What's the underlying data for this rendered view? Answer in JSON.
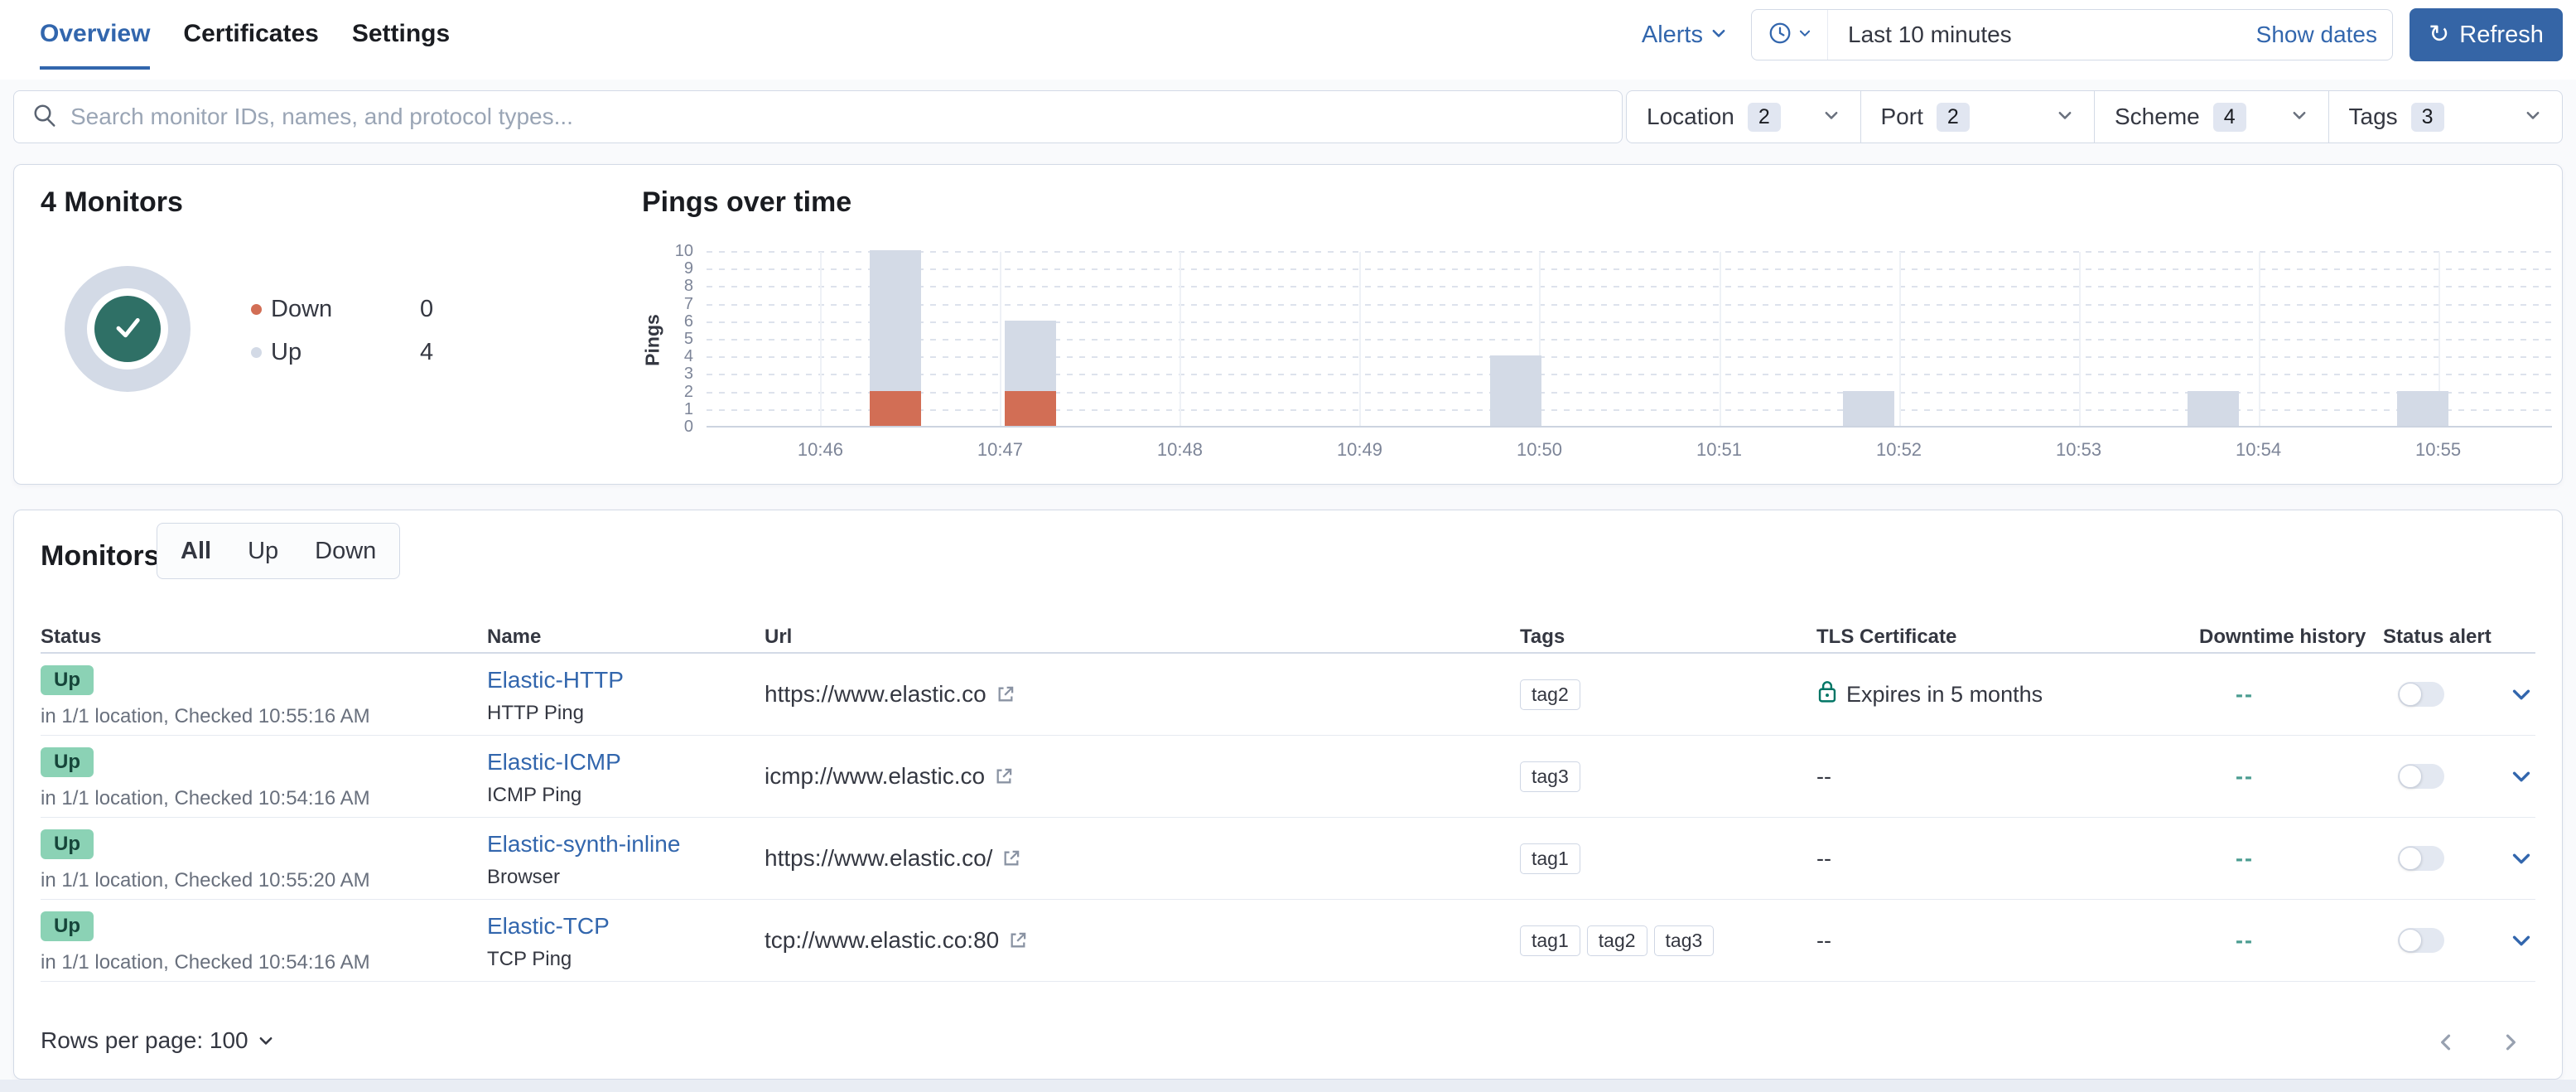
{
  "header": {
    "tabs": [
      {
        "label": "Overview",
        "active": true
      },
      {
        "label": "Certificates",
        "active": false
      },
      {
        "label": "Settings",
        "active": false
      }
    ],
    "alerts_label": "Alerts",
    "time_picker": {
      "range_label": "Last 10 minutes",
      "show_dates_label": "Show dates"
    },
    "refresh_label": "Refresh"
  },
  "search": {
    "placeholder": "Search monitor IDs, names, and protocol types..."
  },
  "filters": [
    {
      "label": "Location",
      "count": "2"
    },
    {
      "label": "Port",
      "count": "2"
    },
    {
      "label": "Scheme",
      "count": "4"
    },
    {
      "label": "Tags",
      "count": "3"
    }
  ],
  "summary": {
    "title": "4 Monitors",
    "legend": [
      {
        "label": "Down",
        "value": "0",
        "color": "#d26e55"
      },
      {
        "label": "Up",
        "value": "4",
        "color": "#d3dae6"
      }
    ]
  },
  "chart_data": {
    "type": "bar",
    "title": "Pings over time",
    "ylabel": "Pings",
    "ylim": [
      0,
      10
    ],
    "yticks": [
      0,
      1,
      2,
      3,
      4,
      5,
      6,
      7,
      8,
      9,
      10
    ],
    "xticks": [
      "10:46",
      "10:47",
      "10:48",
      "10:49",
      "10:50",
      "10:51",
      "10:52",
      "10:53",
      "10:54",
      "10:55"
    ],
    "x_domain": [
      "10:45:22",
      "10:55:38"
    ],
    "grid": true,
    "legend_position": "none",
    "series": [
      {
        "name": "Up",
        "color": "#d3dae6"
      },
      {
        "name": "Down",
        "color": "#d26e55"
      }
    ],
    "bars": [
      {
        "time": "10:46:25",
        "up": 8,
        "down": 2
      },
      {
        "time": "10:47:10",
        "up": 4,
        "down": 2
      },
      {
        "time": "10:49:52",
        "up": 4,
        "down": 0
      },
      {
        "time": "10:51:50",
        "up": 2,
        "down": 0
      },
      {
        "time": "10:53:45",
        "up": 2,
        "down": 0
      },
      {
        "time": "10:54:55",
        "up": 2,
        "down": 0
      }
    ]
  },
  "monitors": {
    "title": "Monitors",
    "status_tabs": [
      {
        "label": "All",
        "active": true
      },
      {
        "label": "Up",
        "active": false
      },
      {
        "label": "Down",
        "active": false
      }
    ],
    "columns": [
      "Status",
      "Name",
      "Url",
      "Tags",
      "TLS Certificate",
      "Downtime history",
      "Status alert"
    ],
    "rows": [
      {
        "status": "Up",
        "status_detail": "in 1/1 location, Checked 10:55:16 AM",
        "name": "Elastic-HTTP",
        "type": "HTTP Ping",
        "url": "https://www.elastic.co",
        "tags": [
          "tag2"
        ],
        "tls": "Expires in 5 months",
        "tls_has_lock": true,
        "downtime": "--",
        "alert_on": false
      },
      {
        "status": "Up",
        "status_detail": "in 1/1 location, Checked 10:54:16 AM",
        "name": "Elastic-ICMP",
        "type": "ICMP Ping",
        "url": "icmp://www.elastic.co",
        "tags": [
          "tag3"
        ],
        "tls": "--",
        "tls_has_lock": false,
        "downtime": "--",
        "alert_on": false
      },
      {
        "status": "Up",
        "status_detail": "in 1/1 location, Checked 10:55:20 AM",
        "name": "Elastic-synth-inline",
        "type": "Browser",
        "url": "https://www.elastic.co/",
        "tags": [
          "tag1"
        ],
        "tls": "--",
        "tls_has_lock": false,
        "downtime": "--",
        "alert_on": false
      },
      {
        "status": "Up",
        "status_detail": "in 1/1 location, Checked 10:54:16 AM",
        "name": "Elastic-TCP",
        "type": "TCP Ping",
        "url": "tcp://www.elastic.co:80",
        "tags": [
          "tag1",
          "tag2",
          "tag3"
        ],
        "tls": "--",
        "tls_has_lock": false,
        "downtime": "--",
        "alert_on": false
      }
    ],
    "rows_per_page_label": "Rows per page: 100"
  },
  "colors": {
    "primary": "#3266ad",
    "up_bar": "#d3dae6",
    "down_bar": "#d26e55",
    "badge_up_bg": "#8bd2b5",
    "donut_center": "#2f7066",
    "border": "#d3dae6",
    "downtime_dash": "#4a9c90"
  }
}
